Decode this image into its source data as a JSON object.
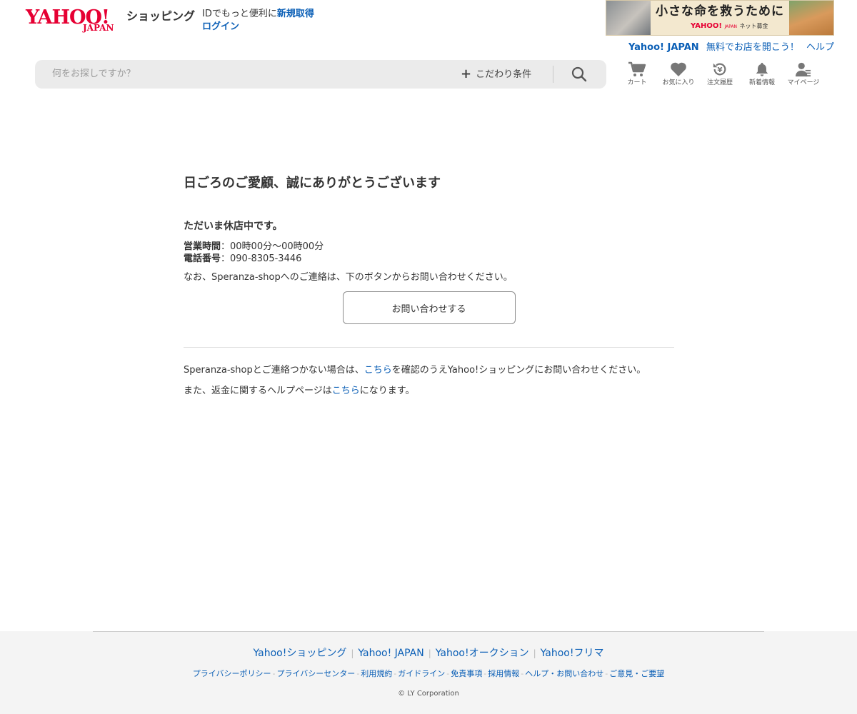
{
  "header": {
    "logo": {
      "yahoo": "YAHOO!",
      "japan": "JAPAN"
    },
    "service_name": "ショッピング",
    "login_promo": "IDでもっと便利に",
    "signup_link": "新規取得",
    "login_link": "ログイン",
    "banner": {
      "headline": "小さな命を救うために",
      "brand": "YAHOO!",
      "brand_sub": "JAPAN",
      "fund": "ネット募金"
    },
    "top_links": [
      "Yahoo! JAPAN",
      "無料でお店を開こう！",
      "ヘルプ"
    ]
  },
  "search": {
    "placeholder": "何をお探しですか？",
    "filter_label": "こだわり条件"
  },
  "nav": [
    {
      "label": "カート",
      "icon": "cart-icon"
    },
    {
      "label": "お気に入り",
      "icon": "heart-icon"
    },
    {
      "label": "注文履歴",
      "icon": "order-history-icon"
    },
    {
      "label": "新着情報",
      "icon": "bell-icon"
    },
    {
      "label": "マイページ",
      "icon": "user-icon"
    }
  ],
  "main": {
    "greeting": "日ごろのご愛顧、誠にありがとうございます",
    "closed_notice": "ただいま休店中です。",
    "hours_label": "営業時間",
    "hours_value": "：00時00分～00時00分",
    "phone_label": "電話番号",
    "phone_value": "：090-8305-3446",
    "contact_note": "なお、Speranza-shopへのご連絡は、下のボタンからお問い合わせください。",
    "contact_button": "お問い合わせする",
    "fallback_pre": "Speranza-shopとご連絡つかない場合は、",
    "fallback_link": "こちら",
    "fallback_post": "を確認のうえYahoo!ショッピングにお問い合わせください。",
    "refund_pre": "また、返金に関するヘルプページは",
    "refund_link": "こちら",
    "refund_post": "になります。"
  },
  "footer": {
    "services": [
      "Yahoo!ショッピング",
      "Yahoo! JAPAN",
      "Yahoo!オークション",
      "Yahoo!フリマ"
    ],
    "links": [
      "プライバシーポリシー",
      "プライバシーセンター",
      "利用規約",
      "ガイドライン",
      "免責事項",
      "採用情報",
      "ヘルプ・お問い合わせ",
      "ご意見・ご要望"
    ],
    "copyright": "© LY Corporation"
  },
  "colors": {
    "brand_red": "#e60033",
    "link_blue": "#0b5fb6",
    "text": "#333333",
    "search_bg": "#ebebeb",
    "footer_bg": "#f4f4f4"
  }
}
